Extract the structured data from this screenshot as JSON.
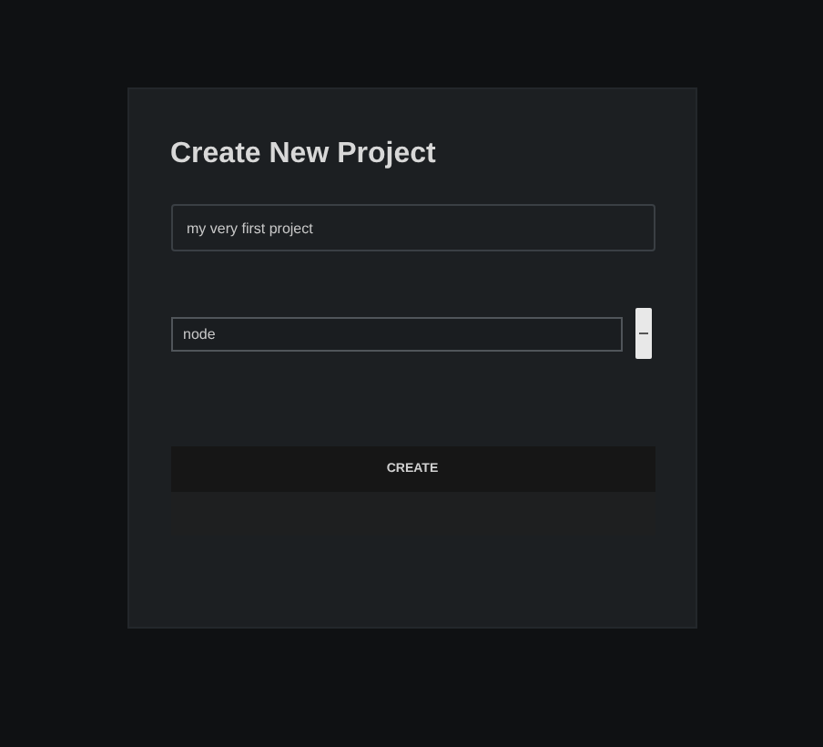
{
  "dialog": {
    "title": "Create New Project"
  },
  "name_field": {
    "value": "my very first project"
  },
  "type_select": {
    "value": "node"
  },
  "create_button": {
    "label": "CREATE"
  }
}
